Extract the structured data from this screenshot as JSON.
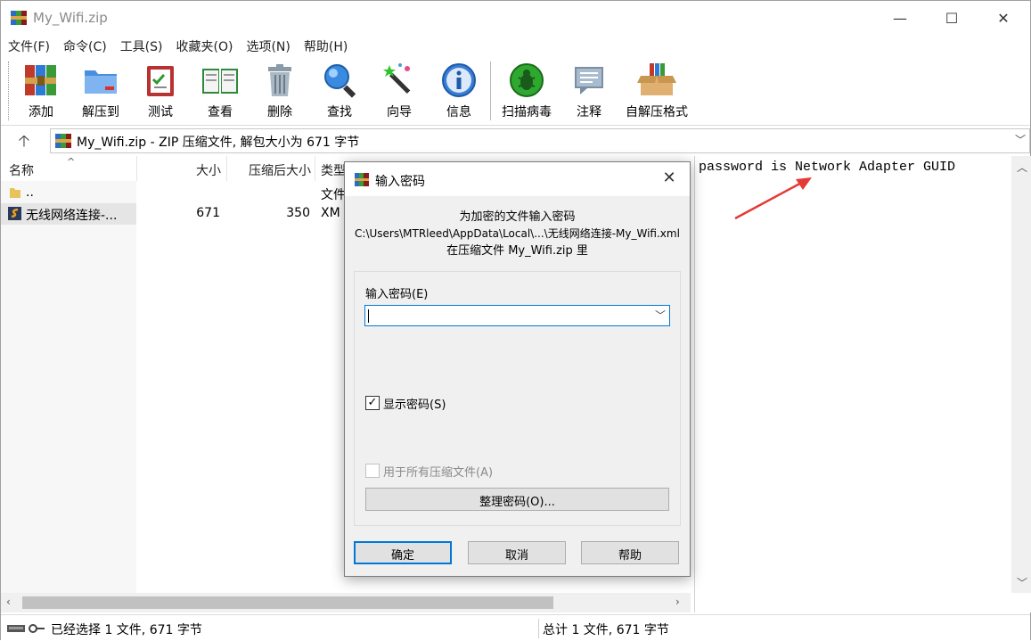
{
  "window": {
    "title": "My_Wifi.zip",
    "minimize": "—",
    "maximize": "☐",
    "close": "✕"
  },
  "menu": [
    "文件(F)",
    "命令(C)",
    "工具(S)",
    "收藏夹(O)",
    "选项(N)",
    "帮助(H)"
  ],
  "toolbar": {
    "add": "添加",
    "extract_to": "解压到",
    "test": "测试",
    "view": "查看",
    "delete": "删除",
    "find": "查找",
    "wizard": "向导",
    "info": "信息",
    "scan_virus": "扫描病毒",
    "comment": "注释",
    "sfx": "自解压格式"
  },
  "address": {
    "up": "🡡",
    "text": "My_Wifi.zip - ZIP 压缩文件, 解包大小为 671 字节"
  },
  "file_list": {
    "headers": {
      "name": "名称",
      "size": "大小",
      "packed": "压缩后大小",
      "type": "类型"
    },
    "rows": [
      {
        "name": "..",
        "size": "",
        "packed": "",
        "type": "文件"
      },
      {
        "name": "无线网络连接-...",
        "size": "671",
        "packed": "350",
        "type": "XM"
      }
    ]
  },
  "comment_text": "password is Network Adapter GUID",
  "status": {
    "left": "已经选择 1 文件, 671 字节",
    "right": "总计 1 文件, 671 字节"
  },
  "dialog": {
    "title": "输入密码",
    "line1": "为加密的文件输入密码",
    "line2": "C:\\Users\\MTRleed\\AppData\\Local\\...\\无线网络连接-My_Wifi.xml",
    "line3": "在压缩文件 My_Wifi.zip 里",
    "password_label": "输入密码(E)",
    "password_value": "",
    "show_password": "显示密码(S)",
    "show_password_checked": true,
    "use_for_all": "用于所有压缩文件(A)",
    "use_for_all_checked": false,
    "organize": "整理密码(O)...",
    "ok": "确定",
    "cancel": "取消",
    "help": "帮助"
  },
  "colors": {
    "accent": "#0078d7",
    "annotation_arrow": "#e53935"
  }
}
